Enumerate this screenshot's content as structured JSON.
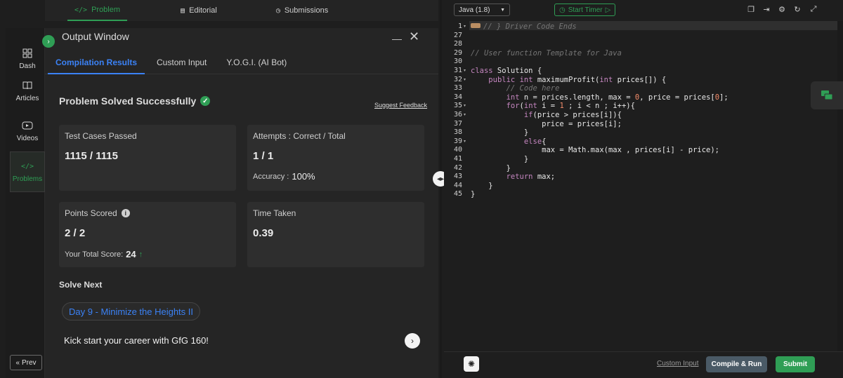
{
  "top_tabs": [
    {
      "label": "Problem",
      "icon": "code-icon",
      "glyph": "</>"
    },
    {
      "label": "Editorial",
      "icon": "document-icon",
      "glyph": "▤"
    },
    {
      "label": "Submissions",
      "icon": "clock-icon",
      "glyph": "◷"
    }
  ],
  "nav": {
    "items": [
      {
        "label": "Dash",
        "icon": "grid-icon"
      },
      {
        "label": "Articles",
        "icon": "book-icon"
      },
      {
        "label": "Videos",
        "icon": "play-icon"
      },
      {
        "label": "Problems",
        "icon": "code-icon"
      }
    ],
    "prev_label": "Prev"
  },
  "output": {
    "title": "Output Window",
    "tabs": [
      "Compilation Results",
      "Custom Input",
      "Y.O.G.I. (AI Bot)"
    ],
    "status": "Problem Solved Successfully",
    "feedback_link": "Suggest Feedback",
    "cards": {
      "tests": {
        "label": "Test Cases Passed",
        "value": "1115 / 1115"
      },
      "attempts": {
        "label": "Attempts : Correct / Total",
        "value": "1 / 1",
        "accuracy_label": "Accuracy :",
        "accuracy_value": "100%"
      },
      "points": {
        "label": "Points Scored",
        "value": "2 / 2",
        "total_label": "Your Total Score:",
        "total_value": "24"
      },
      "time": {
        "label": "Time Taken",
        "value": "0.39"
      }
    },
    "solve_next_heading": "Solve Next",
    "next_problem": "Day 9 - Minimize the Heights II",
    "kick_text": "Kick start your career with GfG 160!"
  },
  "editor": {
    "language": "Java (1.8)",
    "timer_label": "Start Timer",
    "custom_input_label": "Custom Input",
    "compile_label": "Compile & Run",
    "submit_label": "Submit",
    "line_numbers": [
      "1",
      "27",
      "28",
      "29",
      "30",
      "31",
      "32",
      "33",
      "34",
      "35",
      "36",
      "37",
      "38",
      "39",
      "40",
      "41",
      "42",
      "43",
      "44",
      "45"
    ],
    "folded_lines": [
      "1",
      "31",
      "32",
      "35",
      "36",
      "39"
    ],
    "code_lines": [
      "// } Driver Code Ends",
      "",
      "",
      "// User function Template for Java",
      "",
      "class Solution {",
      "    public int maximumProfit(int prices[]) {",
      "        // Code here",
      "        int n = prices.length, max = 0, price = prices[0];",
      "        for(int i = 1 ; i < n ; i++){",
      "            if(price > prices[i]){",
      "                price = prices[i];",
      "            }",
      "            else{",
      "                max = Math.max(max , prices[i] - price);",
      "            }",
      "        }",
      "        return max;",
      "    }",
      "}"
    ]
  },
  "colors": {
    "accent_green": "#2f9e55",
    "accent_blue": "#3b82f6",
    "background": "#1e1e1e",
    "card": "#2e2e2e"
  }
}
